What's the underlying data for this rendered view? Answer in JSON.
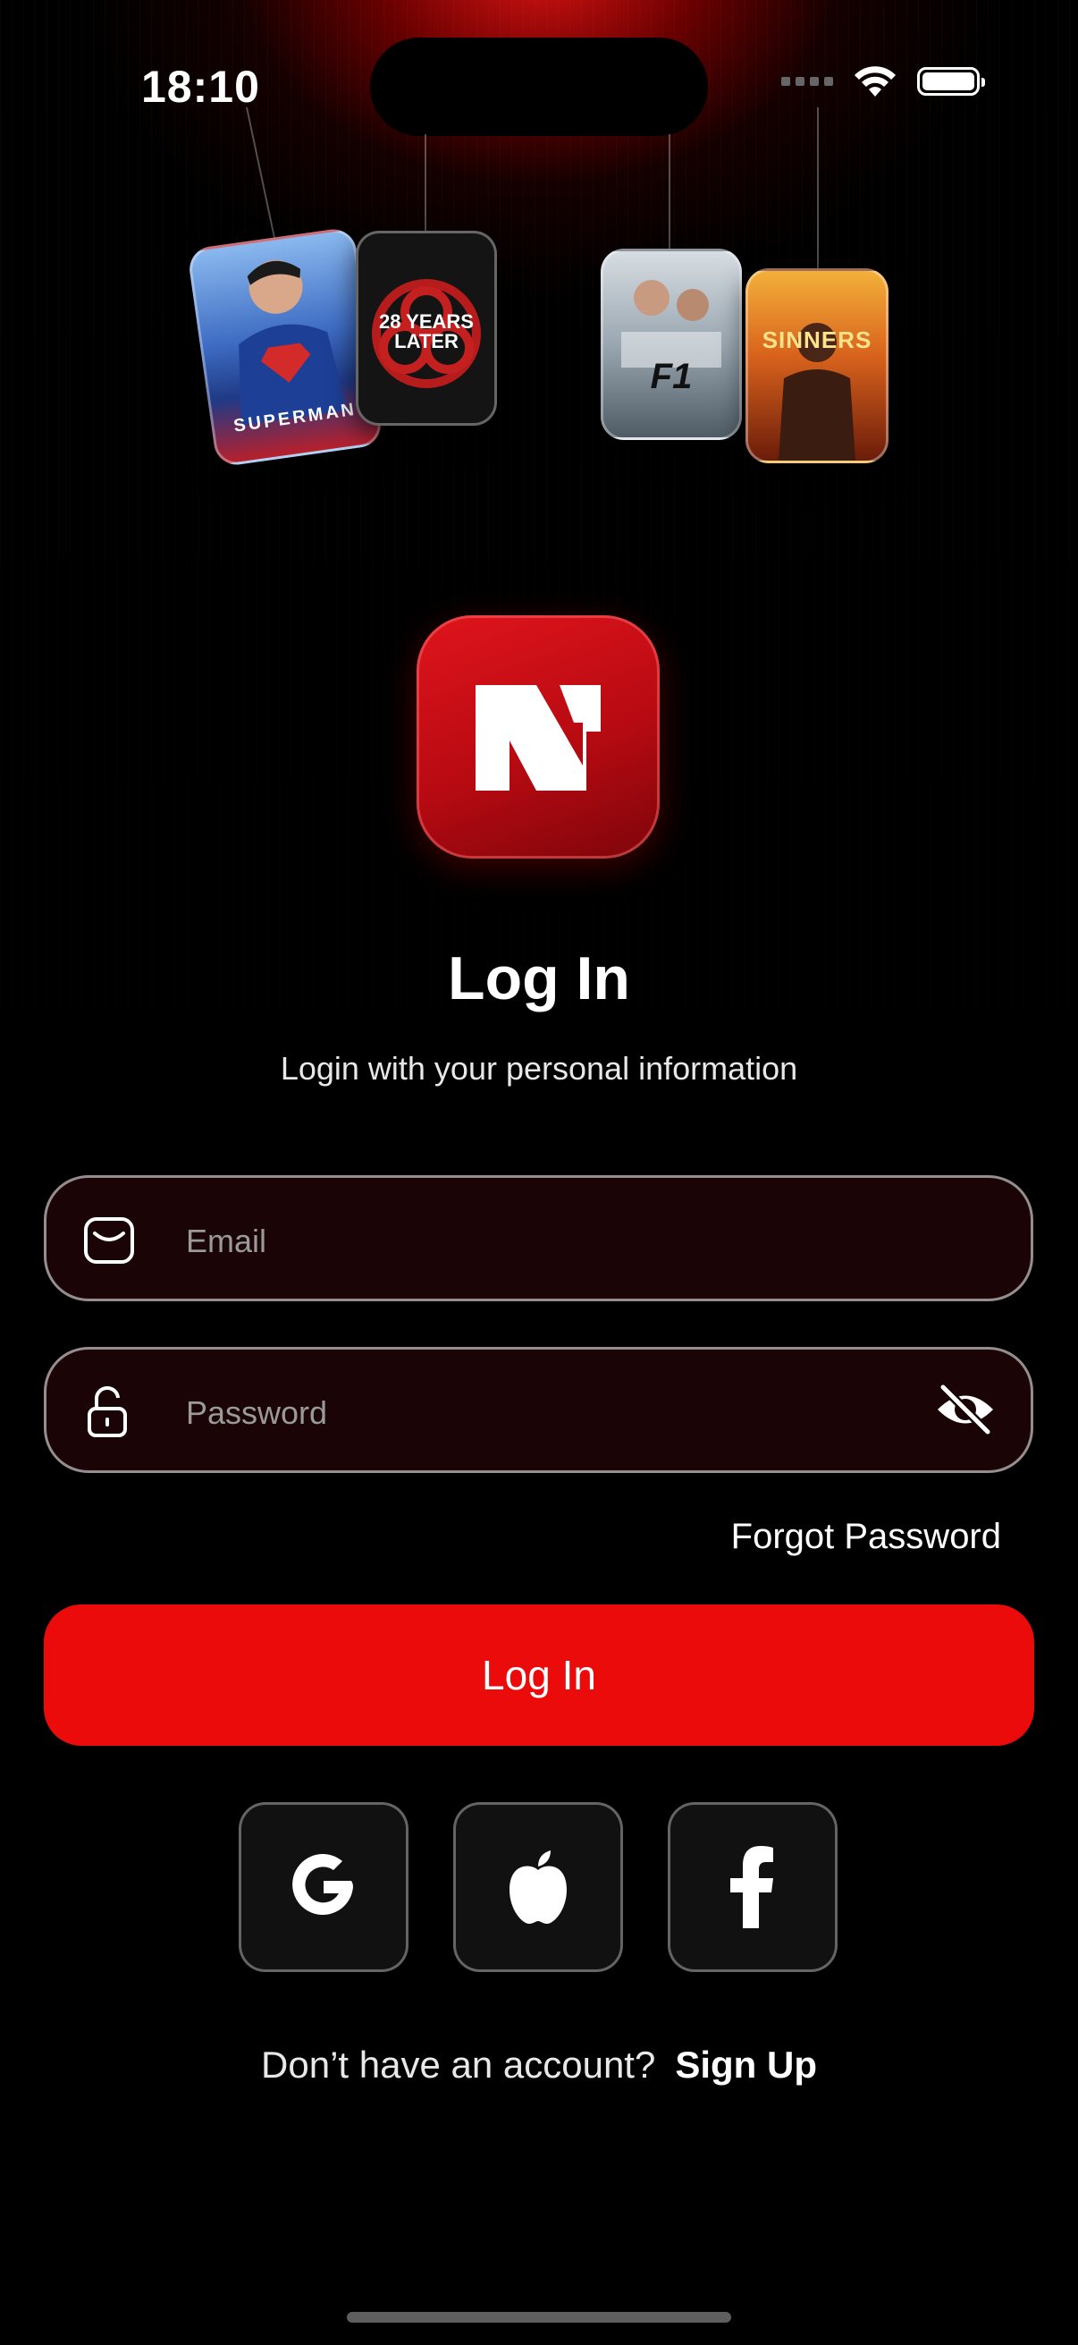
{
  "status_bar": {
    "time": "18:10"
  },
  "posters": [
    {
      "name": "superman",
      "title": "SUPERMAN",
      "colors": [
        "#7fb0e8",
        "#2a4fa8",
        "#c0282e"
      ]
    },
    {
      "name": "28-years-later",
      "title": "28 YEARS LATER",
      "colors": [
        "#151515",
        "#b01818"
      ]
    },
    {
      "name": "f1-the-movie",
      "title": "F1",
      "colors": [
        "#b9c4cc",
        "#5a6670"
      ]
    },
    {
      "name": "sinners",
      "title": "SINNERS",
      "colors": [
        "#f1a12a",
        "#9a2e12"
      ]
    }
  ],
  "header": {
    "title": "Log In",
    "subtitle": "Login with your personal information"
  },
  "form": {
    "email_placeholder": "Email",
    "password_placeholder": "Password",
    "forgot_label": "Forgot Password",
    "submit_label": "Log In"
  },
  "social": {
    "google_icon": "google-icon",
    "apple_icon": "apple-icon",
    "facebook_icon": "facebook-icon"
  },
  "footer": {
    "prompt": "Don’t have an account?",
    "link": "Sign Up"
  },
  "theme": {
    "accent": "#ec0b0b",
    "background": "#000000",
    "field_bg": "#1a0406"
  }
}
